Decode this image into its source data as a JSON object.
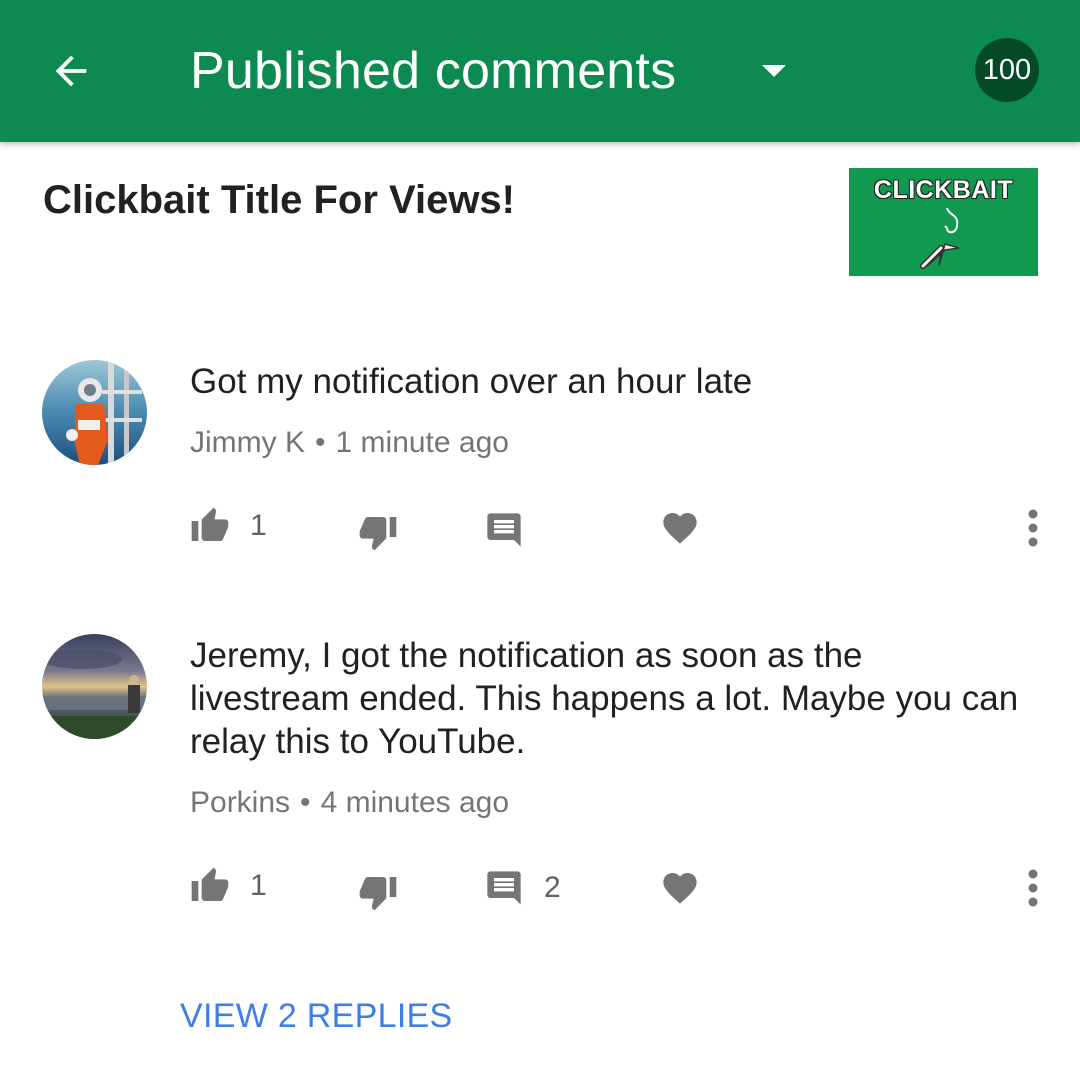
{
  "appbar": {
    "title": "Published comments",
    "count": "100",
    "back_icon": "arrow-left-icon",
    "dropdown_icon": "caret-down-icon",
    "color": "#0c8a51"
  },
  "video": {
    "title": "Clickbait Title For Views!",
    "thumbnail_text": "CLICKBAIT"
  },
  "comments": [
    {
      "text": "Got my notification over an hour late",
      "author": "Jimmy K",
      "separator": "•",
      "time": "1 minute ago",
      "likes": "1",
      "replies": ""
    },
    {
      "text": "Jeremy, I got the notification as soon as the livestream ended. This happens a lot. Maybe you can relay this to YouTube.",
      "author": "Porkins",
      "separator": "•",
      "time": "4 minutes ago",
      "likes": "1",
      "replies": "2"
    }
  ],
  "view_replies_label": "VIEW 2 REPLIES",
  "colors": {
    "accent": "#0c8a51",
    "badge": "#054a28",
    "link": "#3d7fe6",
    "icon": "#757575"
  }
}
